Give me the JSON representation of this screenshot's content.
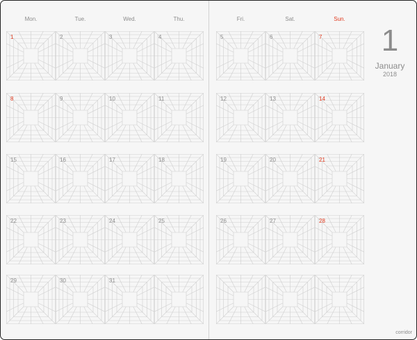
{
  "calendar": {
    "day": "1",
    "month": "January",
    "year": "2018",
    "brand": "corridor",
    "weekdays": [
      "Mon.",
      "Tue.",
      "Wed.",
      "Thu.",
      "Fri.",
      "Sat.",
      "Sun."
    ],
    "weeks": [
      [
        "1",
        "2",
        "3",
        "4",
        "5",
        "6",
        "7"
      ],
      [
        "8",
        "9",
        "10",
        "11",
        "12",
        "13",
        "14"
      ],
      [
        "15",
        "16",
        "17",
        "18",
        "19",
        "20",
        "21"
      ],
      [
        "22",
        "23",
        "24",
        "25",
        "26",
        "27",
        "28"
      ],
      [
        "29",
        "30",
        "31",
        "",
        "",
        "",
        ""
      ]
    ],
    "highlight_days": [
      "1",
      "8",
      "7",
      "14",
      "21",
      "28"
    ],
    "accent_color": "#e0391d",
    "text_color": "#8c8c8c",
    "grid_color": "#cfcfcf"
  }
}
